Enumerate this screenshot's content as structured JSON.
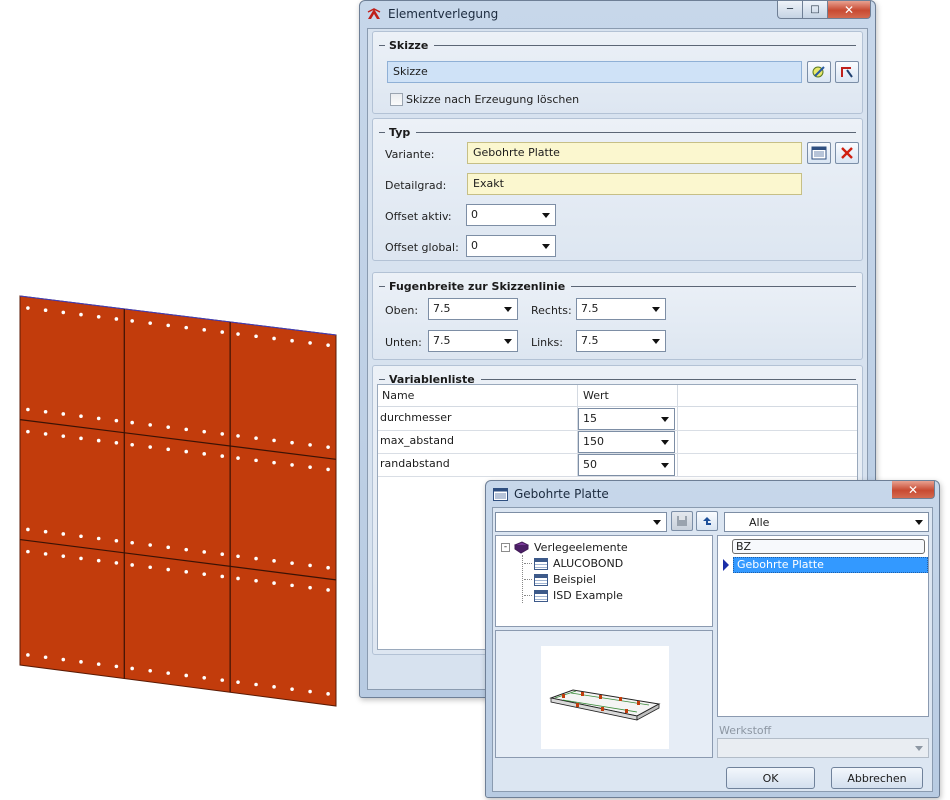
{
  "main_dialog": {
    "title": "Elementverlegung",
    "skizze_group": {
      "title": "Skizze",
      "field_value": "Skizze",
      "checkbox_label": "Skizze nach Erzeugung löschen"
    },
    "typ_group": {
      "title": "Typ",
      "variante_label": "Variante:",
      "variante_value": "Gebohrte Platte",
      "detailgrad_label": "Detailgrad:",
      "detailgrad_value": "Exakt",
      "offset_aktiv_label": "Offset aktiv:",
      "offset_aktiv_value": "0",
      "offset_global_label": "Offset global:",
      "offset_global_value": "0"
    },
    "fugen_group": {
      "title": "Fugenbreite zur Skizzenlinie",
      "oben_label": "Oben:",
      "oben_value": "7.5",
      "rechts_label": "Rechts:",
      "rechts_value": "7.5",
      "unten_label": "Unten:",
      "unten_value": "7.5",
      "links_label": "Links:",
      "links_value": "7.5"
    },
    "variablen_group": {
      "title": "Variablenliste",
      "columns": [
        "Name",
        "Wert"
      ],
      "rows": [
        {
          "name": "durchmesser",
          "value": "15"
        },
        {
          "name": "max_abstand",
          "value": "150"
        },
        {
          "name": "randabstand",
          "value": "50"
        }
      ]
    }
  },
  "sub_dialog": {
    "title": "Gebohrte Platte",
    "path_value": "",
    "filter_value": "Alle",
    "tree": {
      "root": "Verlegeelemente",
      "children": [
        "ALUCOBOND",
        "Beispiel",
        "ISD Example"
      ]
    },
    "list_header": "BZ",
    "list_items": [
      "Gebohrte Platte"
    ],
    "werkstoff_label": "Werkstoff",
    "werkstoff_value": "",
    "ok_label": "OK",
    "cancel_label": "Abbrechen"
  },
  "colors": {
    "panel_fill": "#c23c0c",
    "selection": "#3399ff",
    "variante_field": "#fbf7cf",
    "skizze_field": "#cfe2f7"
  }
}
